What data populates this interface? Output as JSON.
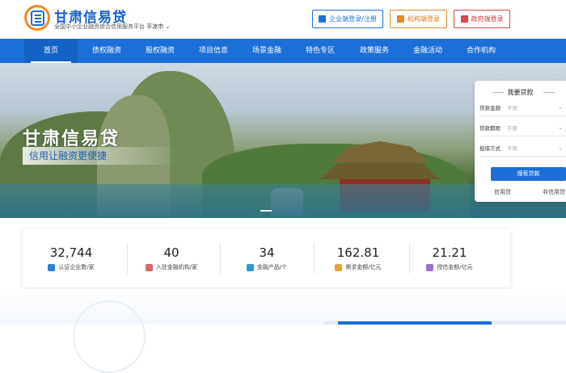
{
  "header": {
    "brand_title": "甘肃信易贷",
    "brand_subtitle": "全国中小企业融资综合信用服务平台",
    "city": "平凉市",
    "city_chevron": "⌄",
    "logo_icon": "xin-logo-icon"
  },
  "login": {
    "enterprise": "企业端登录/注册",
    "institution": "机构端登录",
    "government": "政府端登录"
  },
  "nav": {
    "items": [
      "首页",
      "债权融资",
      "股权融资",
      "项目信息",
      "场景金融",
      "特色专区",
      "政策服务",
      "金融活动",
      "合作机构"
    ],
    "active": "首页"
  },
  "banner": {
    "title": "甘肃信易贷",
    "slogan": "信用让融资更便捷"
  },
  "loan_panel": {
    "title": "我要贷款",
    "rows": [
      {
        "label": "贷款金额",
        "value": "不限"
      },
      {
        "label": "贷款期限",
        "value": "不限"
      },
      {
        "label": "担保方式",
        "value": "不限"
      }
    ],
    "chevron": "⌄",
    "search_label": "搜索贷款",
    "tabs": [
      "信用贷",
      "非信用贷"
    ]
  },
  "stats": [
    {
      "value": "32,744",
      "label": "认证企业数/家",
      "color": "#2f7fe0"
    },
    {
      "value": "40",
      "label": "入驻金融机构/家",
      "color": "#d96a6a"
    },
    {
      "value": "34",
      "label": "金融产品/个",
      "color": "#2a9bd8"
    },
    {
      "value": "162.81",
      "label": "需求金额/亿元",
      "color": "#f0a030"
    },
    {
      "value": "21.21",
      "label": "授信金额/亿元",
      "color": "#9a6fd8"
    }
  ],
  "colors": {
    "primary": "#1b6fd6",
    "orange": "#e08a2a",
    "red": "#d64a4a"
  }
}
